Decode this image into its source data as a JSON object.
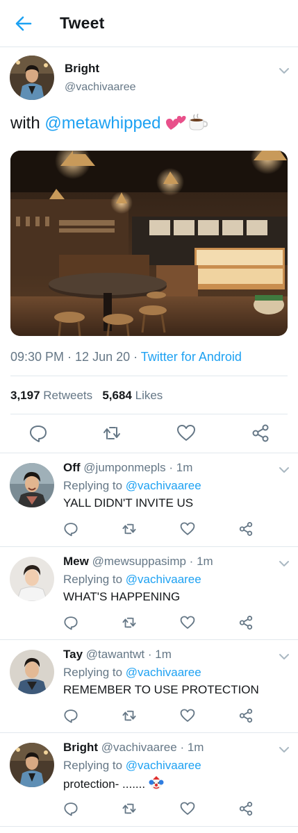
{
  "header": {
    "title": "Tweet",
    "back_icon": "back-arrow-icon",
    "accent": "#1da1f2"
  },
  "tweet": {
    "name": "Bright",
    "handle": "@vachivaaree",
    "text_prefix": "with ",
    "mention": "@metawhipped",
    "emoji": [
      "two-hearts-emoji",
      "coffee-emoji"
    ],
    "image_alt": "cafe-interior-photo",
    "time": "09:30 PM",
    "date": "12 Jun 20",
    "source": "Twitter for Android",
    "retweets_count": "3,197",
    "retweets_label": "Retweets",
    "likes_count": "5,684",
    "likes_label": "Likes",
    "actions": [
      "reply-icon",
      "retweet-icon",
      "like-icon",
      "share-icon"
    ]
  },
  "replies": [
    {
      "name": "Off",
      "handle": "@jumponmepls",
      "time": "1m",
      "replying_label": "Replying to",
      "replying_to": "@vachivaaree",
      "text": "YALL DIDN'T INVITE US"
    },
    {
      "name": "Mew",
      "handle": "@mewsuppasimp",
      "time": "1m",
      "replying_label": "Replying to",
      "replying_to": "@vachivaaree",
      "text": "WHAT'S HAPPENING"
    },
    {
      "name": "Tay",
      "handle": "@tawantwt",
      "time": "1m",
      "replying_label": "Replying to",
      "replying_to": "@vachivaaree",
      "text": "REMEMBER TO USE PROTECTION"
    },
    {
      "name": "Bright",
      "handle": "@vachivaaree",
      "time": "1m",
      "replying_label": "Replying to",
      "replying_to": "@vachivaaree",
      "text": "protection- ....... ",
      "emoji": "clown-emoji"
    }
  ]
}
